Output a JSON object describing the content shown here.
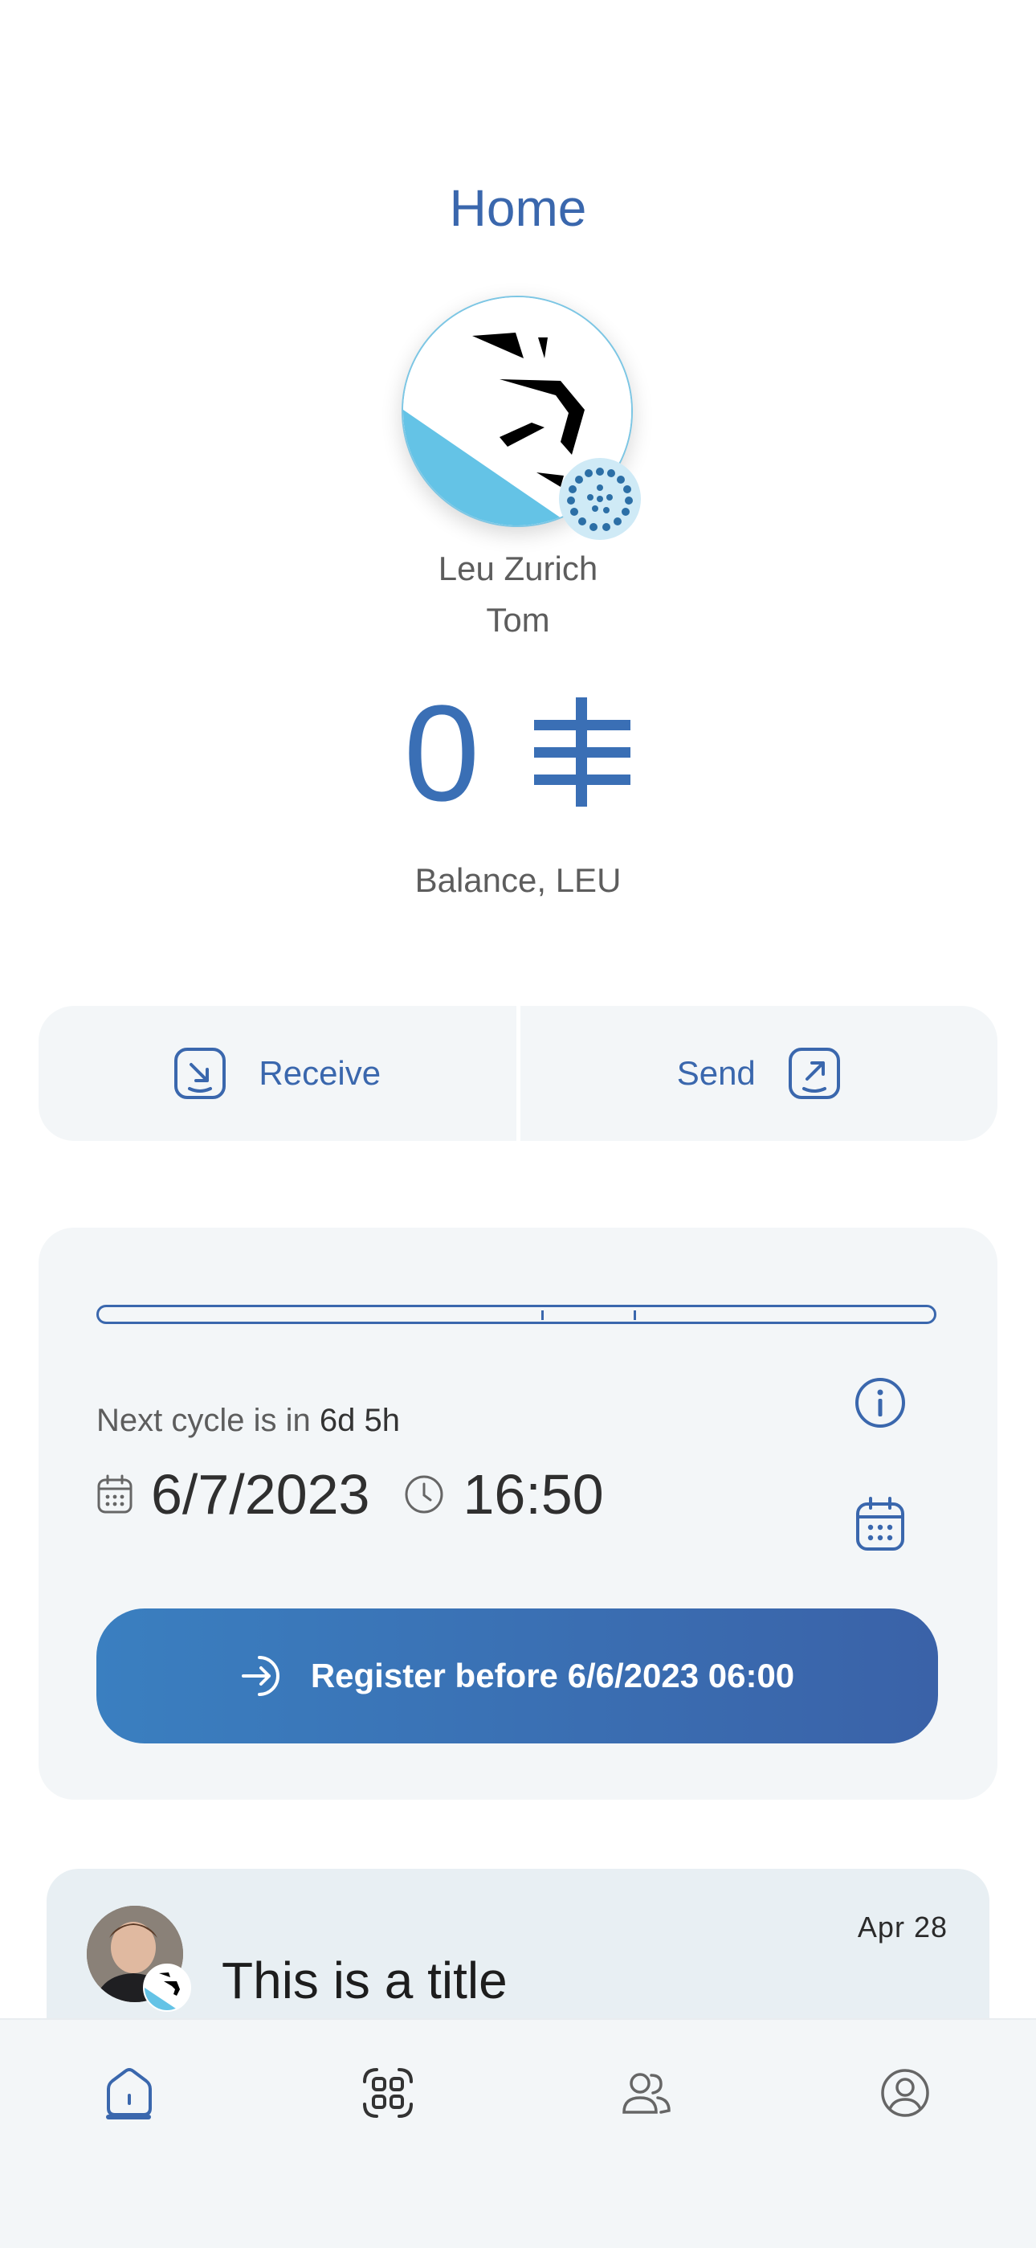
{
  "header": {
    "title": "Home"
  },
  "profile": {
    "community_name": "Leu Zurich",
    "user_name": "Tom",
    "avatar_icon": "lion-logo-icon",
    "badge_icon": "community-dots-icon"
  },
  "balance": {
    "value": "0",
    "currency_symbol": "⫨",
    "label": "Balance, LEU"
  },
  "actions": {
    "receive_label": "Receive",
    "send_label": "Send"
  },
  "cycle": {
    "progress_ticks": [
      0.53,
      0.64
    ],
    "next_cycle_prefix": "Next cycle is in",
    "next_cycle_value": "6d 5h",
    "date": "6/7/2023",
    "time": "16:50",
    "register_label": "Register before 6/6/2023 06:00"
  },
  "news": {
    "title": "This is a title",
    "date": "Apr 28"
  },
  "nav": {
    "items": [
      {
        "name": "home",
        "icon": "home-icon",
        "active": true
      },
      {
        "name": "scan",
        "icon": "qr-scan-icon",
        "active": false
      },
      {
        "name": "contacts",
        "icon": "contacts-icon",
        "active": false
      },
      {
        "name": "profile",
        "icon": "profile-icon",
        "active": false
      }
    ]
  },
  "colors": {
    "accent": "#3a67ad",
    "card_bg": "#f3f6f8",
    "brand_light_blue": "#64c3e6"
  }
}
